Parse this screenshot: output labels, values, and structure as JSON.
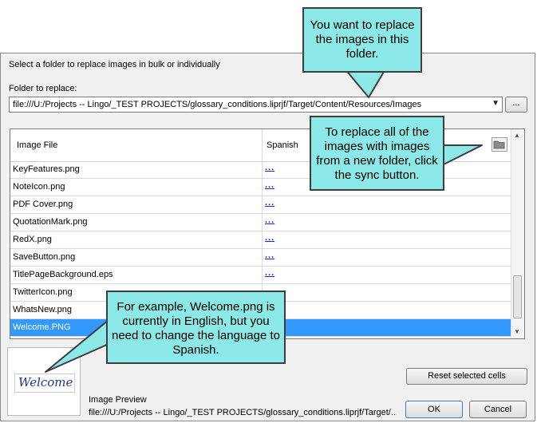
{
  "dialog": {
    "instruction": "Select a folder to replace images in bulk or individually",
    "folder_label": "Folder to replace:",
    "folder_value": "file:///U:/Projects -- Lingo/_TEST PROJECTS/glossary_conditions.liprjf/Target/Content/Resources/Images",
    "browse_label": "...",
    "table": {
      "columns": [
        "Image File",
        "Spanish"
      ],
      "rows": [
        {
          "file": "KeyFeatures.png",
          "spanish": "..."
        },
        {
          "file": "NoteIcon.png",
          "spanish": "..."
        },
        {
          "file": "PDF Cover.png",
          "spanish": "..."
        },
        {
          "file": "QuotationMark.png",
          "spanish": "..."
        },
        {
          "file": "RedX.png",
          "spanish": "..."
        },
        {
          "file": "SaveButton.png",
          "spanish": "..."
        },
        {
          "file": "TitlePageBackground.eps",
          "spanish": "..."
        },
        {
          "file": "TwitterIcon.png",
          "spanish": ""
        },
        {
          "file": "WhatsNew.png",
          "spanish": ""
        },
        {
          "file": "Welcome.PNG",
          "spanish": ""
        }
      ],
      "selected_row": "Welcome.PNG"
    },
    "reset_button": "Reset selected cells",
    "preview_image_text": "Welcome",
    "preview_label": "Image Preview",
    "preview_path": "file:///U:/Projects -- Lingo/_TEST PROJECTS/glossary_conditions.liprjf/Target/...",
    "ok_button": "OK",
    "cancel_button": "Cancel",
    "sync_icon": "folder-icon"
  },
  "callouts": {
    "top": "You want to replace the images in this folder.",
    "right": "To replace all of the images with images from a new folder, click the sync button.",
    "bottom": "For example, Welcome.png is currently in English, but you need to change the language to Spanish."
  },
  "colors": {
    "callout_fill": "#8de8e8",
    "selection": "#3399ff",
    "link": "#0033cc"
  }
}
